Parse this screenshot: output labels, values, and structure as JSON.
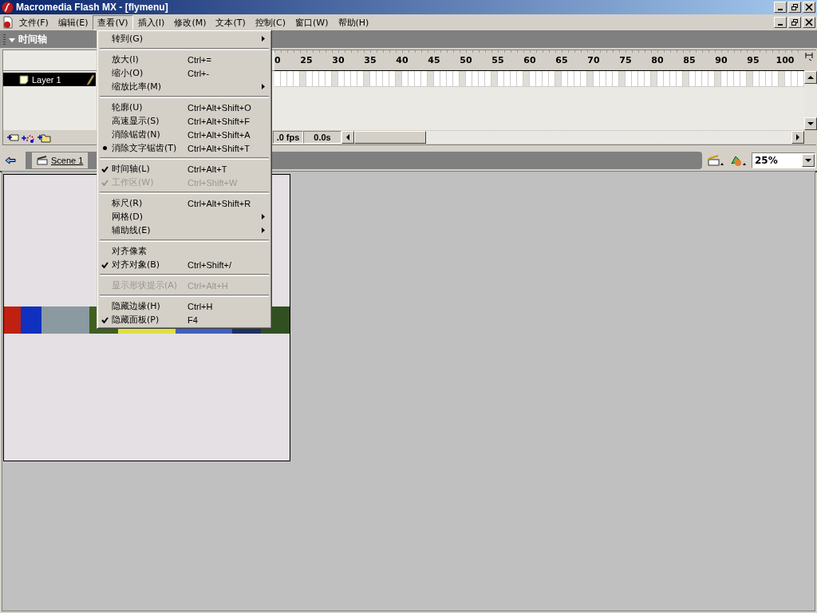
{
  "window": {
    "title": "Macromedia Flash MX - [flymenu]"
  },
  "menubar": [
    {
      "label": "文件(F)",
      "selected": false
    },
    {
      "label": "编辑(E)",
      "selected": false
    },
    {
      "label": "查看(V)",
      "selected": true
    },
    {
      "label": "插入(I)",
      "selected": false
    },
    {
      "label": "修改(M)",
      "selected": false
    },
    {
      "label": "文本(T)",
      "selected": false
    },
    {
      "label": "控制(C)",
      "selected": false
    },
    {
      "label": "窗口(W)",
      "selected": false
    },
    {
      "label": "帮助(H)",
      "selected": false
    }
  ],
  "timeline": {
    "title": "时间轴",
    "expanded": true,
    "layers": [
      {
        "name": "Layer 1",
        "selected": true
      }
    ],
    "ruler": [
      "0",
      "25",
      "30",
      "35",
      "40",
      "45",
      "50",
      "55",
      "60",
      "65",
      "70",
      "75",
      "80",
      "85",
      "90",
      "95",
      "100"
    ],
    "fps": ".0 fps",
    "time": "0.0s"
  },
  "scene_bar": {
    "scene": "Scene 1",
    "zoom": "25%"
  },
  "view_menu": [
    {
      "kind": "submenu",
      "label": "转到(G)",
      "checked": false,
      "disabled": false
    },
    {
      "kind": "separator"
    },
    {
      "kind": "item",
      "label": "放大(I)",
      "shortcut": "Ctrl+=",
      "checked": false,
      "disabled": false
    },
    {
      "kind": "item",
      "label": "缩小(O)",
      "shortcut": "Ctrl+-",
      "checked": false,
      "disabled": false
    },
    {
      "kind": "submenu",
      "label": "缩放比率(M)",
      "checked": false,
      "disabled": false
    },
    {
      "kind": "separator"
    },
    {
      "kind": "radio",
      "label": "轮廓(U)",
      "shortcut": "Ctrl+Alt+Shift+O",
      "checked": false,
      "disabled": false
    },
    {
      "kind": "radio",
      "label": "高速显示(S)",
      "shortcut": "Ctrl+Alt+Shift+F",
      "checked": false,
      "disabled": false
    },
    {
      "kind": "radio",
      "label": "消除锯齿(N)",
      "shortcut": "Ctrl+Alt+Shift+A",
      "checked": false,
      "disabled": false
    },
    {
      "kind": "radio",
      "label": "消除文字锯齿(T)",
      "shortcut": "Ctrl+Alt+Shift+T",
      "checked": true,
      "disabled": false
    },
    {
      "kind": "separator"
    },
    {
      "kind": "item",
      "label": "时间轴(L)",
      "shortcut": "Ctrl+Alt+T",
      "checked": true,
      "disabled": false
    },
    {
      "kind": "item",
      "label": "工作区(W)",
      "shortcut": "Ctrl+Shift+W",
      "checked": true,
      "disabled": true
    },
    {
      "kind": "separator"
    },
    {
      "kind": "item",
      "label": "标尺(R)",
      "shortcut": "Ctrl+Alt+Shift+R",
      "checked": false,
      "disabled": false
    },
    {
      "kind": "submenu",
      "label": "网格(D)",
      "checked": false,
      "disabled": false
    },
    {
      "kind": "submenu",
      "label": "辅助线(E)",
      "checked": false,
      "disabled": false
    },
    {
      "kind": "separator"
    },
    {
      "kind": "item",
      "label": "对齐像素",
      "checked": false,
      "disabled": false
    },
    {
      "kind": "item",
      "label": "对齐对象(B)",
      "shortcut": "Ctrl+Shift+/",
      "checked": true,
      "disabled": false
    },
    {
      "kind": "separator"
    },
    {
      "kind": "item",
      "label": "显示形状提示(A)",
      "shortcut": "Ctrl+Alt+H",
      "checked": false,
      "disabled": true
    },
    {
      "kind": "separator"
    },
    {
      "kind": "item",
      "label": "隐藏边缘(H)",
      "shortcut": "Ctrl+H",
      "checked": false,
      "disabled": false
    },
    {
      "kind": "item",
      "label": "隐藏面板(P)",
      "shortcut": "F4",
      "checked": true,
      "disabled": false
    }
  ]
}
